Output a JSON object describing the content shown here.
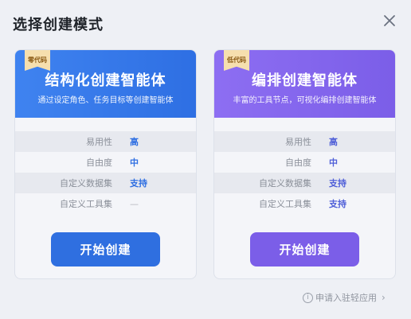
{
  "dialog": {
    "title": "选择创建模式",
    "close_icon": "close-icon"
  },
  "cards": [
    {
      "badge": "零代码",
      "title": "结构化创建智能体",
      "subtitle": "通过设定角色、任务目标等创建智能体",
      "rows": [
        {
          "label": "易用性",
          "value": "高"
        },
        {
          "label": "自由度",
          "value": "中"
        },
        {
          "label": "自定义数据集",
          "value": "支持"
        },
        {
          "label": "自定义工具集",
          "value": "—"
        }
      ],
      "button": "开始创建",
      "accent": "#2f6fe0"
    },
    {
      "badge": "低代码",
      "title": "编排创建智能体",
      "subtitle": "丰富的工具节点，可视化编排创建智能体",
      "rows": [
        {
          "label": "易用性",
          "value": "高"
        },
        {
          "label": "自由度",
          "value": "中"
        },
        {
          "label": "自定义数据集",
          "value": "支持"
        },
        {
          "label": "自定义工具集",
          "value": "支持"
        }
      ],
      "button": "开始创建",
      "accent": "#7b5ee8"
    }
  ],
  "footer": {
    "link": "申请入驻轻应用",
    "info_icon": "info-icon",
    "chevron_icon": "chevron-right-icon"
  }
}
